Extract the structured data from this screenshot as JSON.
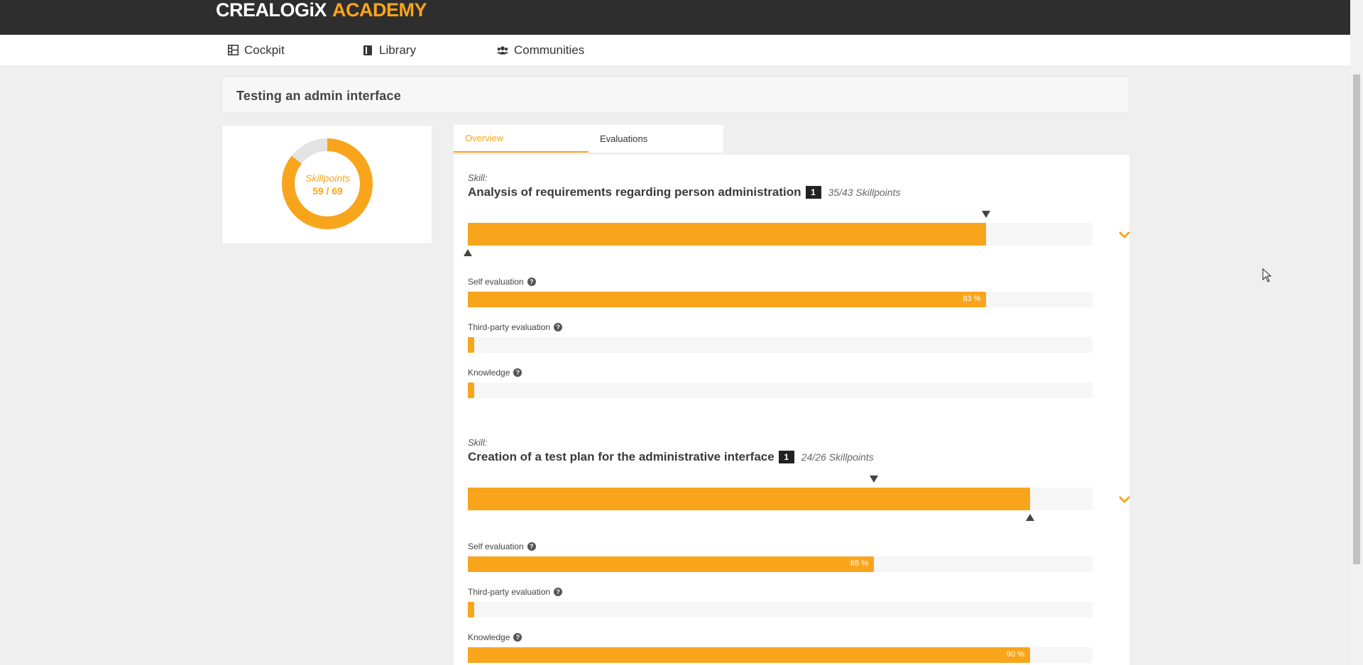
{
  "brand": {
    "part1": "CREALOGiX",
    "part2": "ACADEMY",
    "accent": "#f9a51c"
  },
  "nav": [
    {
      "label": "Cockpit",
      "icon": "grid-icon"
    },
    {
      "label": "Library",
      "icon": "book-icon"
    },
    {
      "label": "Communities",
      "icon": "users-icon"
    }
  ],
  "page_title": "Testing an admin interface",
  "summary": {
    "label": "Skillpoints",
    "value_text": "59 / 69",
    "earned": 59,
    "total": 69
  },
  "tabs": [
    {
      "label": "Overview",
      "active": true
    },
    {
      "label": "Evaluations",
      "active": false
    }
  ],
  "skills": [
    {
      "kicker": "Skill:",
      "name": "Analysis of requirements regarding person administration",
      "level": "1",
      "points_text": "35/43 Skillpoints",
      "main_fraction": 0.83,
      "target_fraction": 0.83,
      "min_fraction": 0.0,
      "evaluations": [
        {
          "label": "Self evaluation",
          "percent": 83,
          "percent_text": "83 %"
        },
        {
          "label": "Third-party evaluation",
          "percent": 1,
          "percent_text": ""
        },
        {
          "label": "Knowledge",
          "percent": 1,
          "percent_text": ""
        }
      ]
    },
    {
      "kicker": "Skill:",
      "name": "Creation of a test plan for the administrative interface",
      "level": "1",
      "points_text": "24/26 Skillpoints",
      "main_fraction": 0.9,
      "target_fraction": 0.65,
      "min_fraction": 0.9,
      "evaluations": [
        {
          "label": "Self evaluation",
          "percent": 65,
          "percent_text": "65 %"
        },
        {
          "label": "Third-party evaluation",
          "percent": 1,
          "percent_text": ""
        },
        {
          "label": "Knowledge",
          "percent": 90,
          "percent_text": "90 %"
        }
      ]
    }
  ]
}
